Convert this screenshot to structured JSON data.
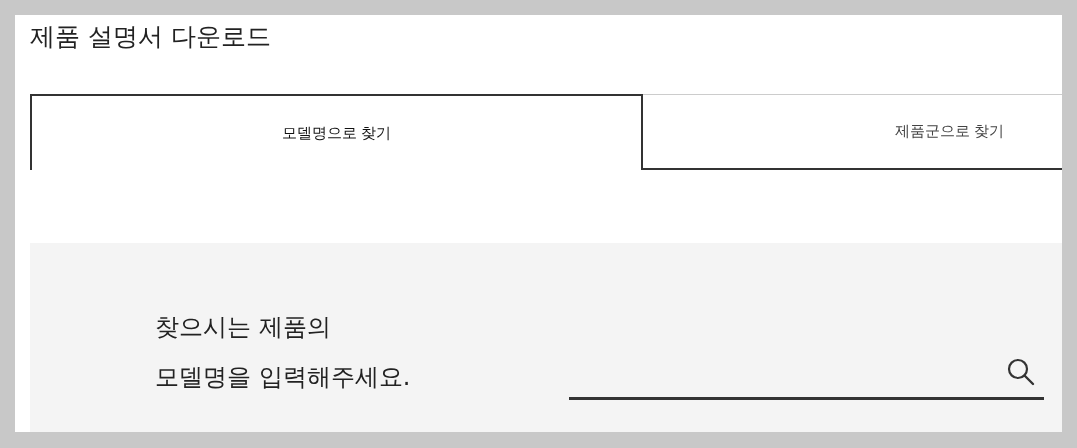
{
  "page_title": "제품 설명서 다운로드",
  "tabs": [
    {
      "label": "모델명으로 찾기",
      "selected": true
    },
    {
      "label": "제품군으로 찾기",
      "selected": false
    }
  ],
  "search": {
    "prompt_lines": [
      "찾으시는 제품의",
      "모델명을 입력해주세요."
    ]
  }
}
